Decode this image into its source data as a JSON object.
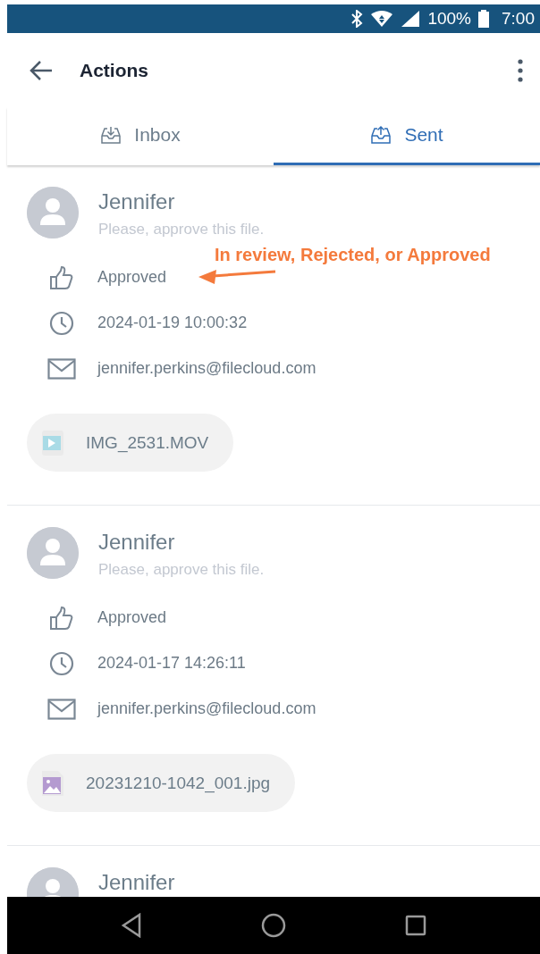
{
  "status_bar": {
    "battery": "100%",
    "time": "7:00"
  },
  "toolbar": {
    "title": "Actions"
  },
  "tabs": [
    {
      "label": "Inbox",
      "kind": "inbox",
      "selected": false
    },
    {
      "label": "Sent",
      "kind": "sent",
      "selected": true
    }
  ],
  "actions": [
    {
      "name": "Jennifer",
      "message": "Please, approve this file.",
      "status": "Approved",
      "date": "2024-01-19 10:00:32",
      "email": "jennifer.perkins@filecloud.com",
      "file": {
        "name": "IMG_2531.MOV",
        "kind": "video"
      }
    },
    {
      "name": "Jennifer",
      "message": "Please, approve this file.",
      "status": "Approved",
      "date": "2024-01-17 14:26:11",
      "email": "jennifer.perkins@filecloud.com",
      "file": {
        "name": "20231210-1042_001.jpg",
        "kind": "image"
      }
    },
    {
      "name": "Jennifer"
    }
  ],
  "annotation": {
    "text": "In review, Rejected, or Approved"
  }
}
